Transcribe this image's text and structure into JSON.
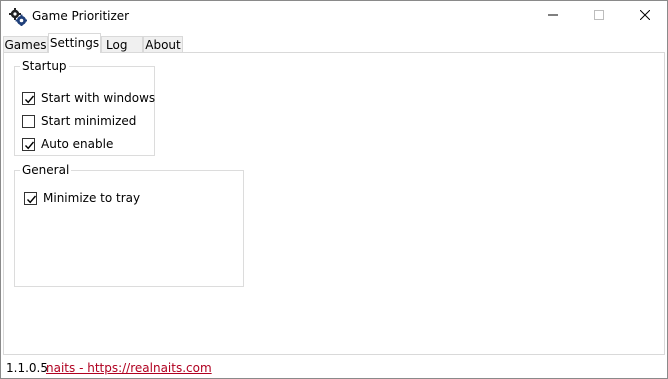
{
  "window": {
    "title": "Game Prioritizer",
    "icon": "gears-icon",
    "controls": [
      "minimize-icon",
      "maximize-icon",
      "close-icon"
    ]
  },
  "tabs": [
    {
      "label": "Games",
      "active": false
    },
    {
      "label": "Settings",
      "active": true
    },
    {
      "label": "Log",
      "active": false
    },
    {
      "label": "About",
      "active": false
    }
  ],
  "settings": {
    "startup": {
      "title": "Startup",
      "options": [
        {
          "label": "Start with windows",
          "checked": true
        },
        {
          "label": "Start minimized",
          "checked": false
        },
        {
          "label": "Auto enable",
          "checked": true
        }
      ]
    },
    "general": {
      "title": "General",
      "options": [
        {
          "label": "Minimize to tray",
          "checked": true
        }
      ]
    }
  },
  "status": {
    "version": "1.1.0.5",
    "link_text": "naits - https://realnaits.com",
    "link_color": "#b00020"
  }
}
